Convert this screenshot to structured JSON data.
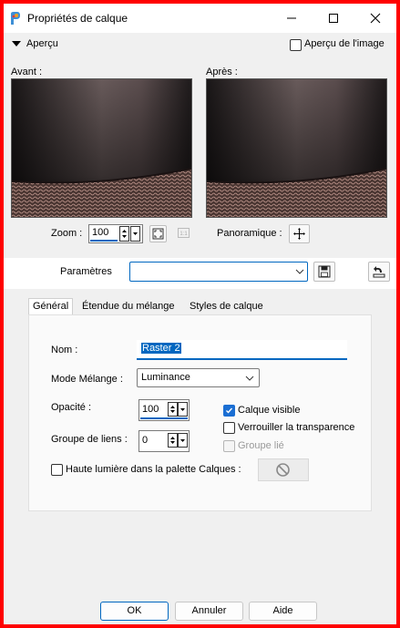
{
  "window": {
    "title": "Propriétés de calque"
  },
  "titlebar": {
    "minimize_icon": "minimize-icon",
    "maximize_icon": "maximize-icon",
    "close_icon": "close-icon"
  },
  "preview_section": {
    "label": "Aperçu",
    "apercu_image_label": "Aperçu de l'image",
    "apercu_image_checked": false,
    "before_label": "Avant :",
    "after_label": "Après :",
    "zoom_label": "Zoom :",
    "zoom_value": "100",
    "pan_label": "Panoramique :"
  },
  "params": {
    "label": "Paramètres",
    "value": ""
  },
  "tabs": [
    {
      "label": "Général",
      "active": true
    },
    {
      "label": "Étendue du mélange",
      "active": false
    },
    {
      "label": "Styles de calque",
      "active": false
    }
  ],
  "general": {
    "name_label": "Nom :",
    "name_value": "Raster 2",
    "blend_label": "Mode Mélange :",
    "blend_value": "Luminance",
    "opacity_label": "Opacité :",
    "opacity_value": "100",
    "group_label": "Groupe de liens :",
    "group_value": "0",
    "visible_label": "Calque visible",
    "visible_checked": true,
    "lock_label": "Verrouiller la transparence",
    "lock_checked": false,
    "linked_label": "Groupe lié",
    "linked_checked": false,
    "highlight_label": "Haute lumière dans la palette Calques :",
    "highlight_checked": false
  },
  "buttons": {
    "ok": "OK",
    "cancel": "Annuler",
    "help": "Aide"
  },
  "colors": {
    "frame": "#ff0000",
    "accent": "#0067c0",
    "window_bg": "#f0f0f0"
  }
}
